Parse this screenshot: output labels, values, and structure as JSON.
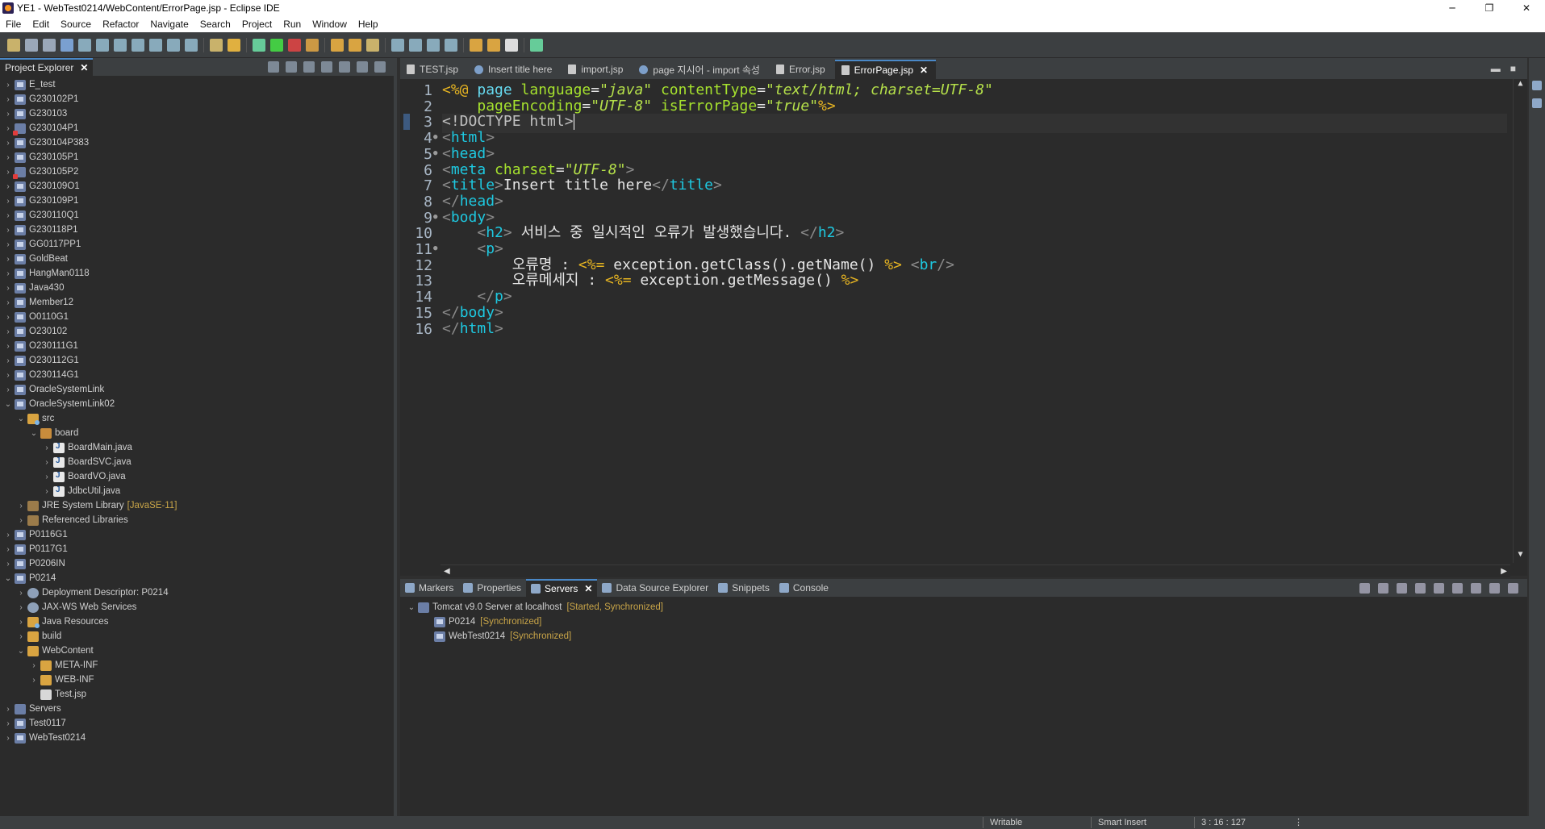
{
  "window": {
    "title": "YE1 - WebTest0214/WebContent/ErrorPage.jsp - Eclipse IDE",
    "minimize": "─",
    "restore": "❐",
    "close": "✕"
  },
  "menu": [
    "File",
    "Edit",
    "Source",
    "Refactor",
    "Navigate",
    "Search",
    "Project",
    "Run",
    "Window",
    "Help"
  ],
  "project_explorer": {
    "tab_label": "Project Explorer",
    "close": "✕",
    "items": [
      {
        "label": "E_test",
        "depth": 0,
        "chev": "›",
        "icon": "project",
        "decor": ""
      },
      {
        "label": "G230102P1",
        "depth": 0,
        "chev": "›",
        "icon": "project",
        "decor": ""
      },
      {
        "label": "G230103",
        "depth": 0,
        "chev": "›",
        "icon": "project",
        "decor": ""
      },
      {
        "label": "G230104P1",
        "depth": 0,
        "chev": "›",
        "icon": "project-err",
        "decor": ""
      },
      {
        "label": "G230104P383",
        "depth": 0,
        "chev": "›",
        "icon": "project",
        "decor": ""
      },
      {
        "label": "G230105P1",
        "depth": 0,
        "chev": "›",
        "icon": "project",
        "decor": ""
      },
      {
        "label": "G230105P2",
        "depth": 0,
        "chev": "›",
        "icon": "project-err",
        "decor": ""
      },
      {
        "label": "G230109O1",
        "depth": 0,
        "chev": "›",
        "icon": "project",
        "decor": ""
      },
      {
        "label": "G230109P1",
        "depth": 0,
        "chev": "›",
        "icon": "project",
        "decor": ""
      },
      {
        "label": "G230110Q1",
        "depth": 0,
        "chev": "›",
        "icon": "project",
        "decor": ""
      },
      {
        "label": "G230118P1",
        "depth": 0,
        "chev": "›",
        "icon": "project",
        "decor": ""
      },
      {
        "label": "GG0117PP1",
        "depth": 0,
        "chev": "›",
        "icon": "project",
        "decor": ""
      },
      {
        "label": "GoldBeat",
        "depth": 0,
        "chev": "›",
        "icon": "project",
        "decor": ""
      },
      {
        "label": "HangMan0118",
        "depth": 0,
        "chev": "›",
        "icon": "project",
        "decor": ""
      },
      {
        "label": "Java430",
        "depth": 0,
        "chev": "›",
        "icon": "project",
        "decor": ""
      },
      {
        "label": "Member12",
        "depth": 0,
        "chev": "›",
        "icon": "project",
        "decor": ""
      },
      {
        "label": "O0110G1",
        "depth": 0,
        "chev": "›",
        "icon": "project",
        "decor": ""
      },
      {
        "label": "O230102",
        "depth": 0,
        "chev": "›",
        "icon": "project",
        "decor": ""
      },
      {
        "label": "O230111G1",
        "depth": 0,
        "chev": "›",
        "icon": "project",
        "decor": ""
      },
      {
        "label": "O230112G1",
        "depth": 0,
        "chev": "›",
        "icon": "project",
        "decor": ""
      },
      {
        "label": "O230114G1",
        "depth": 0,
        "chev": "›",
        "icon": "project",
        "decor": ""
      },
      {
        "label": "OracleSystemLink",
        "depth": 0,
        "chev": "›",
        "icon": "project",
        "decor": ""
      },
      {
        "label": "OracleSystemLink02",
        "depth": 0,
        "chev": "⌄",
        "icon": "project",
        "decor": ""
      },
      {
        "label": "src",
        "depth": 1,
        "chev": "⌄",
        "icon": "srcfolder",
        "decor": ""
      },
      {
        "label": "board",
        "depth": 2,
        "chev": "⌄",
        "icon": "package",
        "decor": ""
      },
      {
        "label": "BoardMain.java",
        "depth": 3,
        "chev": "›",
        "icon": "javafile",
        "decor": ""
      },
      {
        "label": "BoardSVC.java",
        "depth": 3,
        "chev": "›",
        "icon": "javafile",
        "decor": ""
      },
      {
        "label": "BoardVO.java",
        "depth": 3,
        "chev": "›",
        "icon": "javafile",
        "decor": ""
      },
      {
        "label": "JdbcUtil.java",
        "depth": 3,
        "chev": "›",
        "icon": "javafile",
        "decor": ""
      },
      {
        "label": "JRE System Library",
        "depth": 1,
        "chev": "›",
        "icon": "library",
        "decor": "[JavaSE-11]"
      },
      {
        "label": "Referenced Libraries",
        "depth": 1,
        "chev": "›",
        "icon": "library",
        "decor": ""
      },
      {
        "label": "P0116G1",
        "depth": 0,
        "chev": "›",
        "icon": "project",
        "decor": ""
      },
      {
        "label": "P0117G1",
        "depth": 0,
        "chev": "›",
        "icon": "project",
        "decor": ""
      },
      {
        "label": "P0206IN",
        "depth": 0,
        "chev": "›",
        "icon": "project",
        "decor": ""
      },
      {
        "label": "P0214",
        "depth": 0,
        "chev": "⌄",
        "icon": "project",
        "decor": ""
      },
      {
        "label": "Deployment Descriptor: P0214",
        "depth": 1,
        "chev": "›",
        "icon": "gear",
        "decor": ""
      },
      {
        "label": "JAX-WS Web Services",
        "depth": 1,
        "chev": "›",
        "icon": "gear",
        "decor": ""
      },
      {
        "label": "Java Resources",
        "depth": 1,
        "chev": "›",
        "icon": "srcfolder",
        "decor": ""
      },
      {
        "label": "build",
        "depth": 1,
        "chev": "›",
        "icon": "folder",
        "decor": ""
      },
      {
        "label": "WebContent",
        "depth": 1,
        "chev": "⌄",
        "icon": "folder",
        "decor": ""
      },
      {
        "label": "META-INF",
        "depth": 2,
        "chev": "›",
        "icon": "folder",
        "decor": ""
      },
      {
        "label": "WEB-INF",
        "depth": 2,
        "chev": "›",
        "icon": "folder",
        "decor": ""
      },
      {
        "label": "Test.jsp",
        "depth": 2,
        "chev": "",
        "icon": "jspfile",
        "decor": ""
      },
      {
        "label": "Servers",
        "depth": 0,
        "chev": "›",
        "icon": "servers",
        "decor": ""
      },
      {
        "label": "Test0117",
        "depth": 0,
        "chev": "›",
        "icon": "project",
        "decor": ""
      },
      {
        "label": "WebTest0214",
        "depth": 0,
        "chev": "›",
        "icon": "project",
        "decor": ""
      }
    ]
  },
  "editor": {
    "tabs": [
      {
        "label": "TEST.jsp",
        "icon": "file",
        "active": false
      },
      {
        "label": "Insert title here",
        "icon": "globe",
        "active": false
      },
      {
        "label": "import.jsp",
        "icon": "file",
        "active": false
      },
      {
        "label": "page 지시어 - import 속성",
        "icon": "globe",
        "active": false
      },
      {
        "label": "Error.jsp",
        "icon": "file",
        "active": false
      },
      {
        "label": "ErrorPage.jsp",
        "icon": "file",
        "active": true
      }
    ],
    "tab_close": "✕",
    "minimize": "▬",
    "maximize": "■",
    "line_numbers": [
      "1",
      "2",
      "3",
      "4",
      "5",
      "6",
      "7",
      "8",
      "9",
      "10",
      "11",
      "12",
      "13",
      "14",
      "15",
      "16"
    ],
    "fold_lines": [
      4,
      5,
      9,
      11
    ],
    "current_line": 3,
    "lines": [
      [
        {
          "t": "<%@ ",
          "c": "delim"
        },
        {
          "t": "page ",
          "c": "kw"
        },
        {
          "t": "language",
          "c": "attr"
        },
        {
          "t": "=",
          "c": "text"
        },
        {
          "t": "\"java\"",
          "c": "str"
        },
        {
          "t": " ",
          "c": "text"
        },
        {
          "t": "contentType",
          "c": "attr"
        },
        {
          "t": "=",
          "c": "text"
        },
        {
          "t": "\"text/html; charset=UTF-8\"",
          "c": "str"
        }
      ],
      [
        {
          "t": "    ",
          "c": "text"
        },
        {
          "t": "pageEncoding",
          "c": "attr"
        },
        {
          "t": "=",
          "c": "text"
        },
        {
          "t": "\"UTF-8\"",
          "c": "str"
        },
        {
          "t": " ",
          "c": "text"
        },
        {
          "t": "isErrorPage",
          "c": "attr"
        },
        {
          "t": "=",
          "c": "text"
        },
        {
          "t": "\"true\"",
          "c": "str"
        },
        {
          "t": "%>",
          "c": "delim"
        }
      ],
      [
        {
          "t": "<!DOCTYPE html>",
          "c": "doctype"
        }
      ],
      [
        {
          "t": "<",
          "c": "angle"
        },
        {
          "t": "html",
          "c": "tag"
        },
        {
          "t": ">",
          "c": "angle"
        }
      ],
      [
        {
          "t": "<",
          "c": "angle"
        },
        {
          "t": "head",
          "c": "tag"
        },
        {
          "t": ">",
          "c": "angle"
        }
      ],
      [
        {
          "t": "<",
          "c": "angle"
        },
        {
          "t": "meta ",
          "c": "tag"
        },
        {
          "t": "charset",
          "c": "attr"
        },
        {
          "t": "=",
          "c": "text"
        },
        {
          "t": "\"UTF-8\"",
          "c": "str"
        },
        {
          "t": ">",
          "c": "angle"
        }
      ],
      [
        {
          "t": "<",
          "c": "angle"
        },
        {
          "t": "title",
          "c": "tag"
        },
        {
          "t": ">",
          "c": "angle"
        },
        {
          "t": "Insert title here",
          "c": "text"
        },
        {
          "t": "</",
          "c": "angle"
        },
        {
          "t": "title",
          "c": "tag"
        },
        {
          "t": ">",
          "c": "angle"
        }
      ],
      [
        {
          "t": "</",
          "c": "angle"
        },
        {
          "t": "head",
          "c": "tag"
        },
        {
          "t": ">",
          "c": "angle"
        }
      ],
      [
        {
          "t": "<",
          "c": "angle"
        },
        {
          "t": "body",
          "c": "tag"
        },
        {
          "t": ">",
          "c": "angle"
        }
      ],
      [
        {
          "t": "    ",
          "c": "text"
        },
        {
          "t": "<",
          "c": "angle"
        },
        {
          "t": "h2",
          "c": "tag"
        },
        {
          "t": "> ",
          "c": "angle"
        },
        {
          "t": "서비스 중 일시적인 오류가 발생했습니다. ",
          "c": "text"
        },
        {
          "t": "</",
          "c": "angle"
        },
        {
          "t": "h2",
          "c": "tag"
        },
        {
          "t": ">",
          "c": "angle"
        }
      ],
      [
        {
          "t": "    ",
          "c": "text"
        },
        {
          "t": "<",
          "c": "angle"
        },
        {
          "t": "p",
          "c": "tag"
        },
        {
          "t": ">",
          "c": "angle"
        }
      ],
      [
        {
          "t": "        오류명 : ",
          "c": "text"
        },
        {
          "t": "<%= ",
          "c": "delim"
        },
        {
          "t": "exception.getClass().getName() ",
          "c": "java"
        },
        {
          "t": "%>",
          "c": "delim"
        },
        {
          "t": " ",
          "c": "text"
        },
        {
          "t": "<",
          "c": "angle"
        },
        {
          "t": "br",
          "c": "tag"
        },
        {
          "t": "/>",
          "c": "angle"
        }
      ],
      [
        {
          "t": "        오류메세지 : ",
          "c": "text"
        },
        {
          "t": "<%= ",
          "c": "delim"
        },
        {
          "t": "exception.getMessage() ",
          "c": "java"
        },
        {
          "t": "%>",
          "c": "delim"
        }
      ],
      [
        {
          "t": "    ",
          "c": "text"
        },
        {
          "t": "</",
          "c": "angle"
        },
        {
          "t": "p",
          "c": "tag"
        },
        {
          "t": ">",
          "c": "angle"
        }
      ],
      [
        {
          "t": "</",
          "c": "angle"
        },
        {
          "t": "body",
          "c": "tag"
        },
        {
          "t": ">",
          "c": "angle"
        }
      ],
      [
        {
          "t": "</",
          "c": "angle"
        },
        {
          "t": "html",
          "c": "tag"
        },
        {
          "t": ">",
          "c": "angle"
        }
      ]
    ],
    "scroll_up": "▲",
    "scroll_down": "▼",
    "scroll_left": "◀",
    "scroll_right": "▶"
  },
  "bottom_panel": {
    "tabs": [
      {
        "label": "Markers",
        "active": false
      },
      {
        "label": "Properties",
        "active": false
      },
      {
        "label": "Servers",
        "active": true
      },
      {
        "label": "Data Source Explorer",
        "active": false
      },
      {
        "label": "Snippets",
        "active": false
      },
      {
        "label": "Console",
        "active": false
      }
    ],
    "tab_close": "✕",
    "servers": [
      {
        "label": "Tomcat v9.0 Server at localhost",
        "status": "[Started, Synchronized]",
        "depth": 0,
        "chev": "⌄"
      },
      {
        "label": "P0214",
        "status": "[Synchronized]",
        "depth": 1,
        "chev": ""
      },
      {
        "label": "WebTest0214",
        "status": "[Synchronized]",
        "depth": 1,
        "chev": ""
      }
    ]
  },
  "status_bar": {
    "writable": "Writable",
    "insert_mode": "Smart Insert",
    "position": "3 : 16 : 127",
    "more": "⋮"
  },
  "colors": {
    "background": "#2b2b2b",
    "chrome": "#3c3f41",
    "accent": "#4a88c7",
    "jsp_delim": "#e6b422",
    "tag": "#1ec8e0",
    "attr": "#a6e22e",
    "string": "#b5e04a"
  }
}
